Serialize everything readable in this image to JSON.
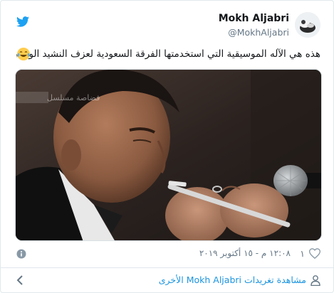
{
  "author": {
    "name": "Mokh Aljabri",
    "handle": "@MokhAljabri"
  },
  "tweet": {
    "text": "هذه هي الآله الموسيقية التي استخدمتها الفرقة السعودية لعزف النشيد الوطني الروسي",
    "emoji": "face-with-tears-of-joy"
  },
  "media": {
    "watermark": "فضاصة مسلسل"
  },
  "meta": {
    "like_count": "١",
    "timestamp": "١٢:٠٨ م - ١٥ أكتوبر ٢٠١٩"
  },
  "more": {
    "label": "مشاهدة تغريدات Mokh Aljabri الأخرى"
  },
  "colors": {
    "twitter_blue": "#1da1f2",
    "link_blue": "#1b95e0",
    "muted": "#657786",
    "border": "#e1e8ed"
  }
}
